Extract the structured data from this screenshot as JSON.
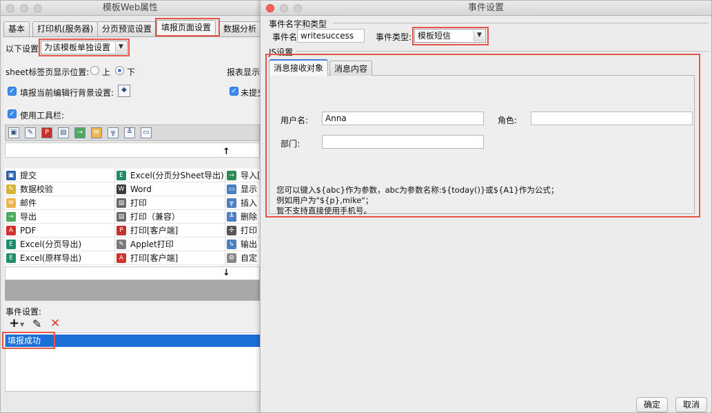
{
  "left_window": {
    "title": "模板Web属性",
    "tabs": [
      {
        "label": "基本"
      },
      {
        "label": "打印机(服务器)"
      },
      {
        "label": "分页预览设置"
      },
      {
        "label": "填报页面设置"
      },
      {
        "label": "数据分析设"
      }
    ],
    "settings_label": "以下设置",
    "settings_value": "为该模板单独设置",
    "sheet_tab_label": "sheet标签页显示位置:",
    "radio_top": "上",
    "radio_bottom": "下",
    "report_display_label": "报表显示",
    "fill_bg_label": "填报当前编辑行背景设置:",
    "unsubmitted_label": "未提交",
    "use_toolbar_label": "使用工具栏:",
    "up_arrow": "↑",
    "down_arrow": "↓",
    "buttons": [
      [
        "提交",
        "Excel(分页分Sheet导出)",
        "导入["
      ],
      [
        "数据校验",
        "Word",
        "显示"
      ],
      [
        "邮件",
        "打印",
        "插入"
      ],
      [
        "导出",
        "打印（兼容）",
        "删除"
      ],
      [
        "PDF",
        "打印[客户端]",
        "打印"
      ],
      [
        "Excel(分页导出)",
        "Applet打印",
        "输出"
      ],
      [
        "Excel(原样导出)",
        "打印[客户端]",
        "自定"
      ]
    ],
    "event_settings_label": "事件设置:",
    "add_icon": "+",
    "edit_icon": "✎",
    "delete_icon": "✕",
    "event_item": "填报成功"
  },
  "right_window": {
    "title": "事件设置",
    "group_name_type": "事件名字和类型",
    "event_name_label": "事件名:",
    "event_name_value": "writesuccess",
    "event_type_label": "事件类型:",
    "event_type_value": "模板短信",
    "js_group": "JS设置",
    "tab_recipients": "消息接收对象",
    "tab_content": "消息内容",
    "user_label": "用户名:",
    "user_value": "Anna",
    "role_label": "角色:",
    "role_value": "",
    "dept_label": "部门:",
    "dept_value": "",
    "hint_1": "您可以键入${abc}作为参数，abc为参数名称:${today()}或${A1}作为公式；",
    "hint_2": "例如用户为\"${p},mike\"；",
    "hint_3": "暂不支持直接使用手机号。",
    "ok_button": "确定",
    "cancel_button": "取消"
  },
  "colors": {
    "highlight_red": "#e45548",
    "selection_blue": "#1b6fd6",
    "checkbox_blue": "#3b8cf2"
  }
}
